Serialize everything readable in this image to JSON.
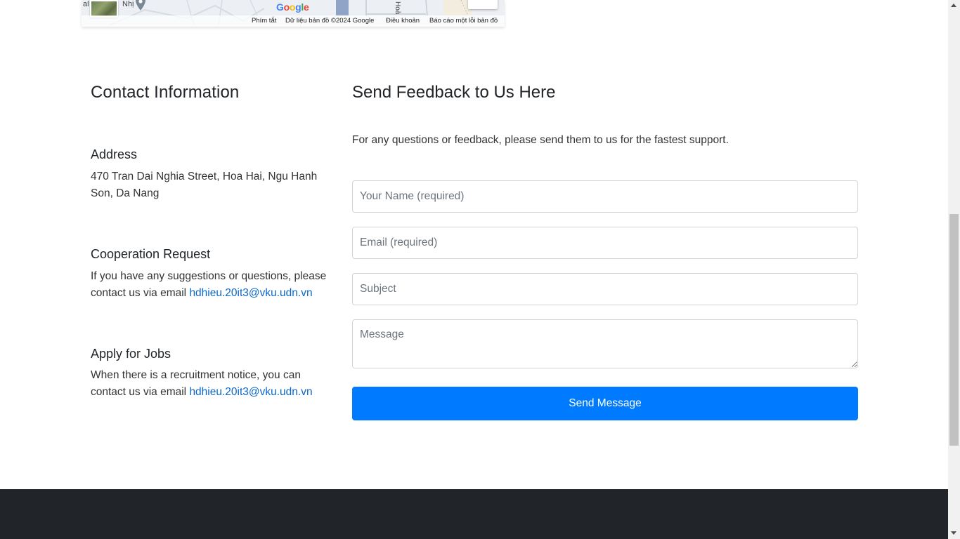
{
  "map": {
    "logo_text": "Google",
    "fragment_left": "al",
    "fragment_pin_label": "Nhị",
    "fragment_street": "Hoà",
    "attribution": {
      "shortcuts": "Phím tắt",
      "data": "Dữ liệu bản đồ ©2024 Google",
      "terms": "Điều khoản",
      "report": "Báo cáo một lỗi bản đồ"
    }
  },
  "contact": {
    "title": "Contact Information",
    "address": {
      "title": "Address",
      "text": "470 Tran Dai Nghia Street, Hoa Hai, Ngu Hanh Son, Da Nang"
    },
    "cooperation": {
      "title": "Cooperation Request",
      "text": "If you have any suggestions or questions, please contact us via email ",
      "email": "hdhieu.20it3@vku.udn.vn"
    },
    "jobs": {
      "title": "Apply for Jobs",
      "text": "When there is a recruitment notice, you can contact us via email ",
      "email": "hdhieu.20it3@vku.udn.vn"
    }
  },
  "feedback": {
    "title": "Send Feedback to Us Here",
    "intro": "For any questions or feedback, please send them to us for the fastest support.",
    "name_placeholder": "Your Name (required)",
    "email_placeholder": "Email (required)",
    "subject_placeholder": "Subject",
    "message_placeholder": "Message",
    "send_label": "Send Message"
  },
  "colors": {
    "primary": "#007bff",
    "link": "#0a67c8",
    "footer": "#212529",
    "heading": "#212529"
  },
  "icons": {
    "map_pin": "map-pin-icon",
    "scroll_up": "scroll-up-arrow",
    "scroll_down": "scroll-down-arrow"
  }
}
